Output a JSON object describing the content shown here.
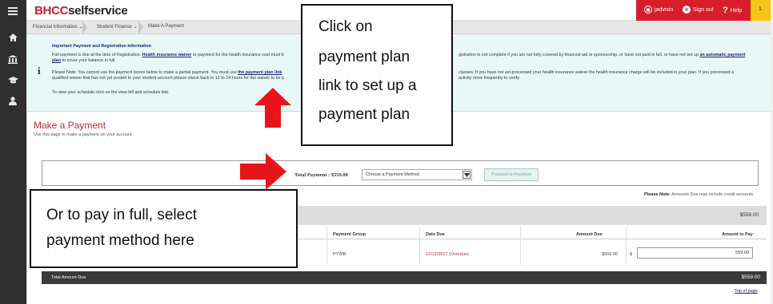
{
  "header": {
    "brand_part1": "BHCC",
    "brand_part2": "selfservice",
    "user": "jadvisin",
    "sign_out": "Sign out",
    "help": "Help",
    "notification_count": "1"
  },
  "breadcrumb": {
    "items": [
      "Financial Information",
      "Student Finance",
      "Make A Payment"
    ]
  },
  "info_panel": {
    "heading": "Important Payment and Registration Information",
    "line1_a": "Full payment is due at the time of Registration.",
    "line1_link": "Health insurance waiver",
    "line1_b": "or payment for the health insurance cost must b",
    "line1_c": "gistration is not complete if you are not fully covered by financial aid or sponsorship, or have not paid in full, or have not set up",
    "line1_link2": "an automatic payment",
    "line2_link": "plan",
    "line2_b": "to cover your balance in full.",
    "line3_a": "Please Note: You cannot use the payment boxes below to make a partial payment. You must use",
    "line3_link": "the payment plan link",
    "line3_c": "classes. If you have not yet processed your health insurance waiver the health insurance charge will be included in your plan. If you processed a",
    "line4_a": "qualified waiver that has not yet posted to your student account please check back in 12 to 24 hours for the waiver to be p",
    "line4_c": "activity more frequently to verify.",
    "line5": "To view your schedule click on the view bill and schedule link."
  },
  "make_payment": {
    "title": "Make a Payment",
    "subtitle": "Use this page to make a payment on your account",
    "total_payment": "Total Payment : $559.00",
    "payment_method_placeholder": "Choose a Payment Method",
    "proceed_label": "Proceed to Payment",
    "please_note_label": "Please Note:",
    "please_note_text": "Amounts Due may include credit amounts.",
    "group_total": "$559.00",
    "columns": [
      "Payment Group",
      "Date Due",
      "Amount Due",
      "Amount to Pay"
    ],
    "row": {
      "payment_group": "PYWB",
      "date_due": "12/12/2017 (Overdue)",
      "amount_due": "$559.00",
      "currency": "$",
      "amount_to_pay": "559.00"
    },
    "total_label": "Total Amount Due",
    "total_amount": "$559.00",
    "top_of_page": "Top of page"
  },
  "callouts": {
    "top_lines": [
      "Click on",
      "payment plan",
      "link to set up a",
      "payment plan"
    ],
    "bottom_lines": [
      "Or to pay in full, select",
      "payment method here"
    ]
  },
  "icons": {
    "rail": [
      "hamburger-icon",
      "home-icon",
      "bank-icon",
      "graduation-cap-icon",
      "person-icon"
    ],
    "info": "info-icon",
    "dropdown": "chevron-down-icon",
    "arrows": [
      "red-up-arrow-icon",
      "red-right-arrow-icon"
    ]
  },
  "colors": {
    "brand_red": "#cc1f2f",
    "header_red": "#d81e2c",
    "header_yellow": "#f5c518",
    "info_bg": "#e9f8f7",
    "arrow_red": "#e8141a",
    "overdue_red": "#c62828",
    "rail_dark": "#2f2f2f"
  }
}
